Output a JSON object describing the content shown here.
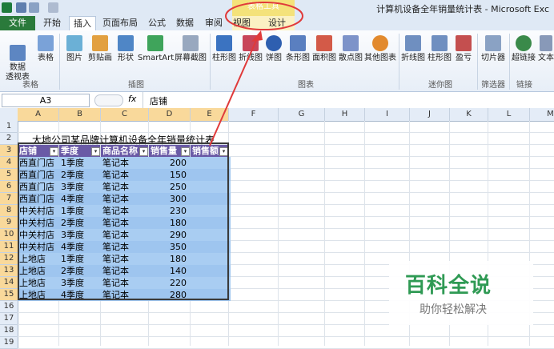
{
  "window": {
    "title": "计算机设备全年销量统计表 - Microsoft Exc",
    "contextual_group": "表格工具"
  },
  "tabs": [
    "文件",
    "开始",
    "插入",
    "页面布局",
    "公式",
    "数据",
    "审阅",
    "视图",
    "设计"
  ],
  "ribbon": {
    "buttons": [
      {
        "label": "数据\n透视表"
      },
      {
        "label": "表格"
      },
      {
        "label": "图片"
      },
      {
        "label": "剪贴画"
      },
      {
        "label": "形状"
      },
      {
        "label": "SmartArt"
      },
      {
        "label": "屏幕截图"
      },
      {
        "label": "柱形图"
      },
      {
        "label": "折线图"
      },
      {
        "label": "饼图"
      },
      {
        "label": "条形图"
      },
      {
        "label": "面积图"
      },
      {
        "label": "散点图"
      },
      {
        "label": "其他图表"
      },
      {
        "label": "折线图"
      },
      {
        "label": "柱形图"
      },
      {
        "label": "盈亏"
      },
      {
        "label": "切片器"
      },
      {
        "label": "超链接"
      },
      {
        "label": "文本"
      }
    ],
    "groups": [
      "表格",
      "插图",
      "图表",
      "迷你图",
      "筛选器",
      "链接"
    ]
  },
  "formula_bar": {
    "name_box": "A3",
    "fx": "fx",
    "content": "店铺"
  },
  "columns": [
    "A",
    "B",
    "C",
    "D",
    "E",
    "F",
    "G",
    "H",
    "I",
    "J",
    "K",
    "L",
    "M"
  ],
  "rows": [
    "1",
    "2",
    "3",
    "4",
    "5",
    "6",
    "7",
    "8",
    "9",
    "10",
    "11",
    "12",
    "13",
    "14",
    "15",
    "16",
    "17",
    "18",
    "19"
  ],
  "sheet": {
    "title": "大地公司某品牌计算机设备全年销量统计表",
    "headers": [
      "店铺",
      "季度",
      "商品名称",
      "销售量",
      "销售额"
    ],
    "data": [
      [
        "西直门店",
        "1季度",
        "笔记本",
        "200"
      ],
      [
        "西直门店",
        "2季度",
        "笔记本",
        "150"
      ],
      [
        "西直门店",
        "3季度",
        "笔记本",
        "250"
      ],
      [
        "西直门店",
        "4季度",
        "笔记本",
        "300"
      ],
      [
        "中关村店",
        "1季度",
        "笔记本",
        "230"
      ],
      [
        "中关村店",
        "2季度",
        "笔记本",
        "180"
      ],
      [
        "中关村店",
        "3季度",
        "笔记本",
        "290"
      ],
      [
        "中关村店",
        "4季度",
        "笔记本",
        "350"
      ],
      [
        "上地店",
        "1季度",
        "笔记本",
        "180"
      ],
      [
        "上地店",
        "2季度",
        "笔记本",
        "140"
      ],
      [
        "上地店",
        "3季度",
        "笔记本",
        "220"
      ],
      [
        "上地店",
        "4季度",
        "笔记本",
        "280"
      ]
    ]
  },
  "watermark": {
    "brand": "百科全说",
    "tagline": "助你轻松解决"
  },
  "colors": {
    "header_fill": "#6a5aa6",
    "band_fill": "#9ec5ef",
    "annotation": "#e03a3a",
    "file_tab": "#2a7a3b",
    "watermark_green": "#2f9a54"
  }
}
